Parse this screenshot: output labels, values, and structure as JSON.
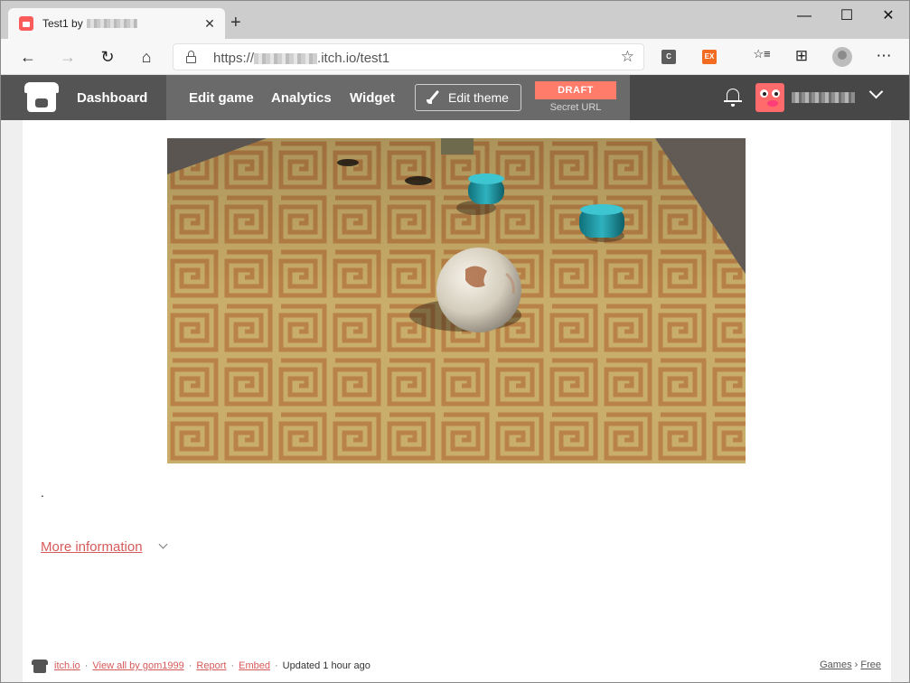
{
  "browser": {
    "tab_title_prefix": "Test1 by",
    "tab_close": "✕",
    "new_tab": "+",
    "window_controls": {
      "minimize": "—",
      "maximize": "☐",
      "close": "✕"
    },
    "nav": {
      "back": "←",
      "forward": "→",
      "refresh": "↻",
      "home": "⌂"
    },
    "url_prefix": "https://",
    "url_suffix": ".itch.io/test1",
    "star": "☆",
    "extensions": [
      {
        "label": "C",
        "color": "#5c5c5c"
      },
      {
        "label": "EX",
        "color": "#f26b21"
      }
    ],
    "toolbar_icons": {
      "favorites": "☆≡",
      "collections": "⊞",
      "more": "⋯"
    }
  },
  "itch_header": {
    "dashboard": "Dashboard",
    "edit_game": "Edit game",
    "analytics": "Analytics",
    "widget": "Widget",
    "edit_theme": "Edit theme",
    "draft": "DRAFT",
    "secret_url": "Secret URL"
  },
  "content": {
    "description": ".",
    "more_information": "More information"
  },
  "footer": {
    "itchio": "itch.io",
    "view_all": "View all by gom1999",
    "report": "Report",
    "embed": "Embed",
    "updated": "Updated 1 hour ago",
    "games": "Games",
    "breadcrumb_sep": "›",
    "free": "Free",
    "sep": "·"
  },
  "colors": {
    "accent": "#d75a5a",
    "header_bg": "#474747",
    "draft_badge": "#ff7c6b"
  }
}
